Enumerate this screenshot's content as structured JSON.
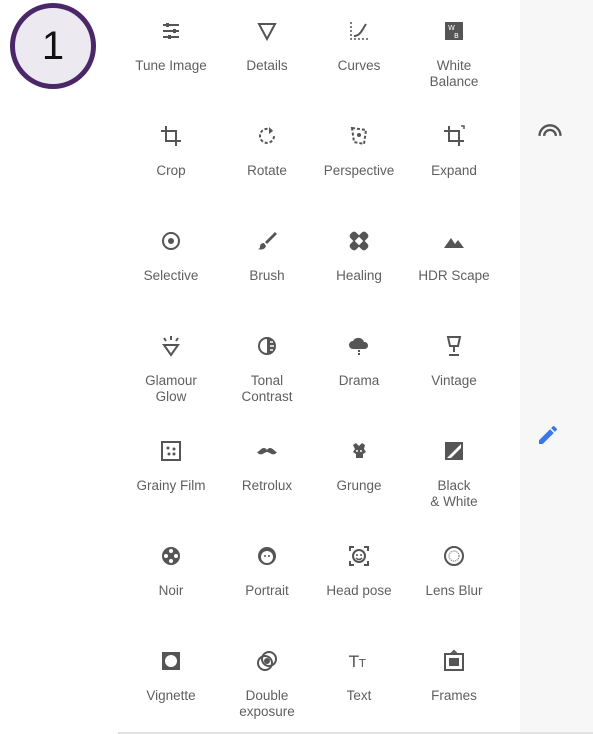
{
  "step_badge": "1",
  "colors": {
    "icon": "#555555",
    "label": "#5f5f5f",
    "edit_accent": "#3b78e7",
    "badge_border": "#4a2769"
  },
  "tools": [
    {
      "label": "Tune Image",
      "icon": "sliders-icon"
    },
    {
      "label": "Details",
      "icon": "triangle-icon"
    },
    {
      "label": "Curves",
      "icon": "curves-icon"
    },
    {
      "label": "White\nBalance",
      "icon": "white-balance-icon"
    },
    {
      "label": "Crop",
      "icon": "crop-icon"
    },
    {
      "label": "Rotate",
      "icon": "rotate-icon"
    },
    {
      "label": "Perspective",
      "icon": "perspective-icon"
    },
    {
      "label": "Expand",
      "icon": "expand-icon"
    },
    {
      "label": "Selective",
      "icon": "selective-icon"
    },
    {
      "label": "Brush",
      "icon": "brush-icon"
    },
    {
      "label": "Healing",
      "icon": "bandage-icon"
    },
    {
      "label": "HDR Scape",
      "icon": "mountains-icon"
    },
    {
      "label": "Glamour\nGlow",
      "icon": "glamour-icon"
    },
    {
      "label": "Tonal\nContrast",
      "icon": "tonal-contrast-icon"
    },
    {
      "label": "Drama",
      "icon": "cloud-icon"
    },
    {
      "label": "Vintage",
      "icon": "lamp-icon"
    },
    {
      "label": "Grainy Film",
      "icon": "grain-icon"
    },
    {
      "label": "Retrolux",
      "icon": "mustache-icon"
    },
    {
      "label": "Grunge",
      "icon": "grunge-icon"
    },
    {
      "label": "Black\n& White",
      "icon": "black-white-icon"
    },
    {
      "label": "Noir",
      "icon": "film-reel-icon"
    },
    {
      "label": "Portrait",
      "icon": "face-icon"
    },
    {
      "label": "Head pose",
      "icon": "head-pose-icon"
    },
    {
      "label": "Lens Blur",
      "icon": "lens-blur-icon"
    },
    {
      "label": "Vignette",
      "icon": "vignette-icon"
    },
    {
      "label": "Double\nexposure",
      "icon": "double-exposure-icon"
    },
    {
      "label": "Text",
      "icon": "text-icon"
    },
    {
      "label": "Frames",
      "icon": "frame-icon"
    }
  ],
  "rail": {
    "top_icon": "styles-arc-icon",
    "middle_icon": "pencil-icon"
  }
}
